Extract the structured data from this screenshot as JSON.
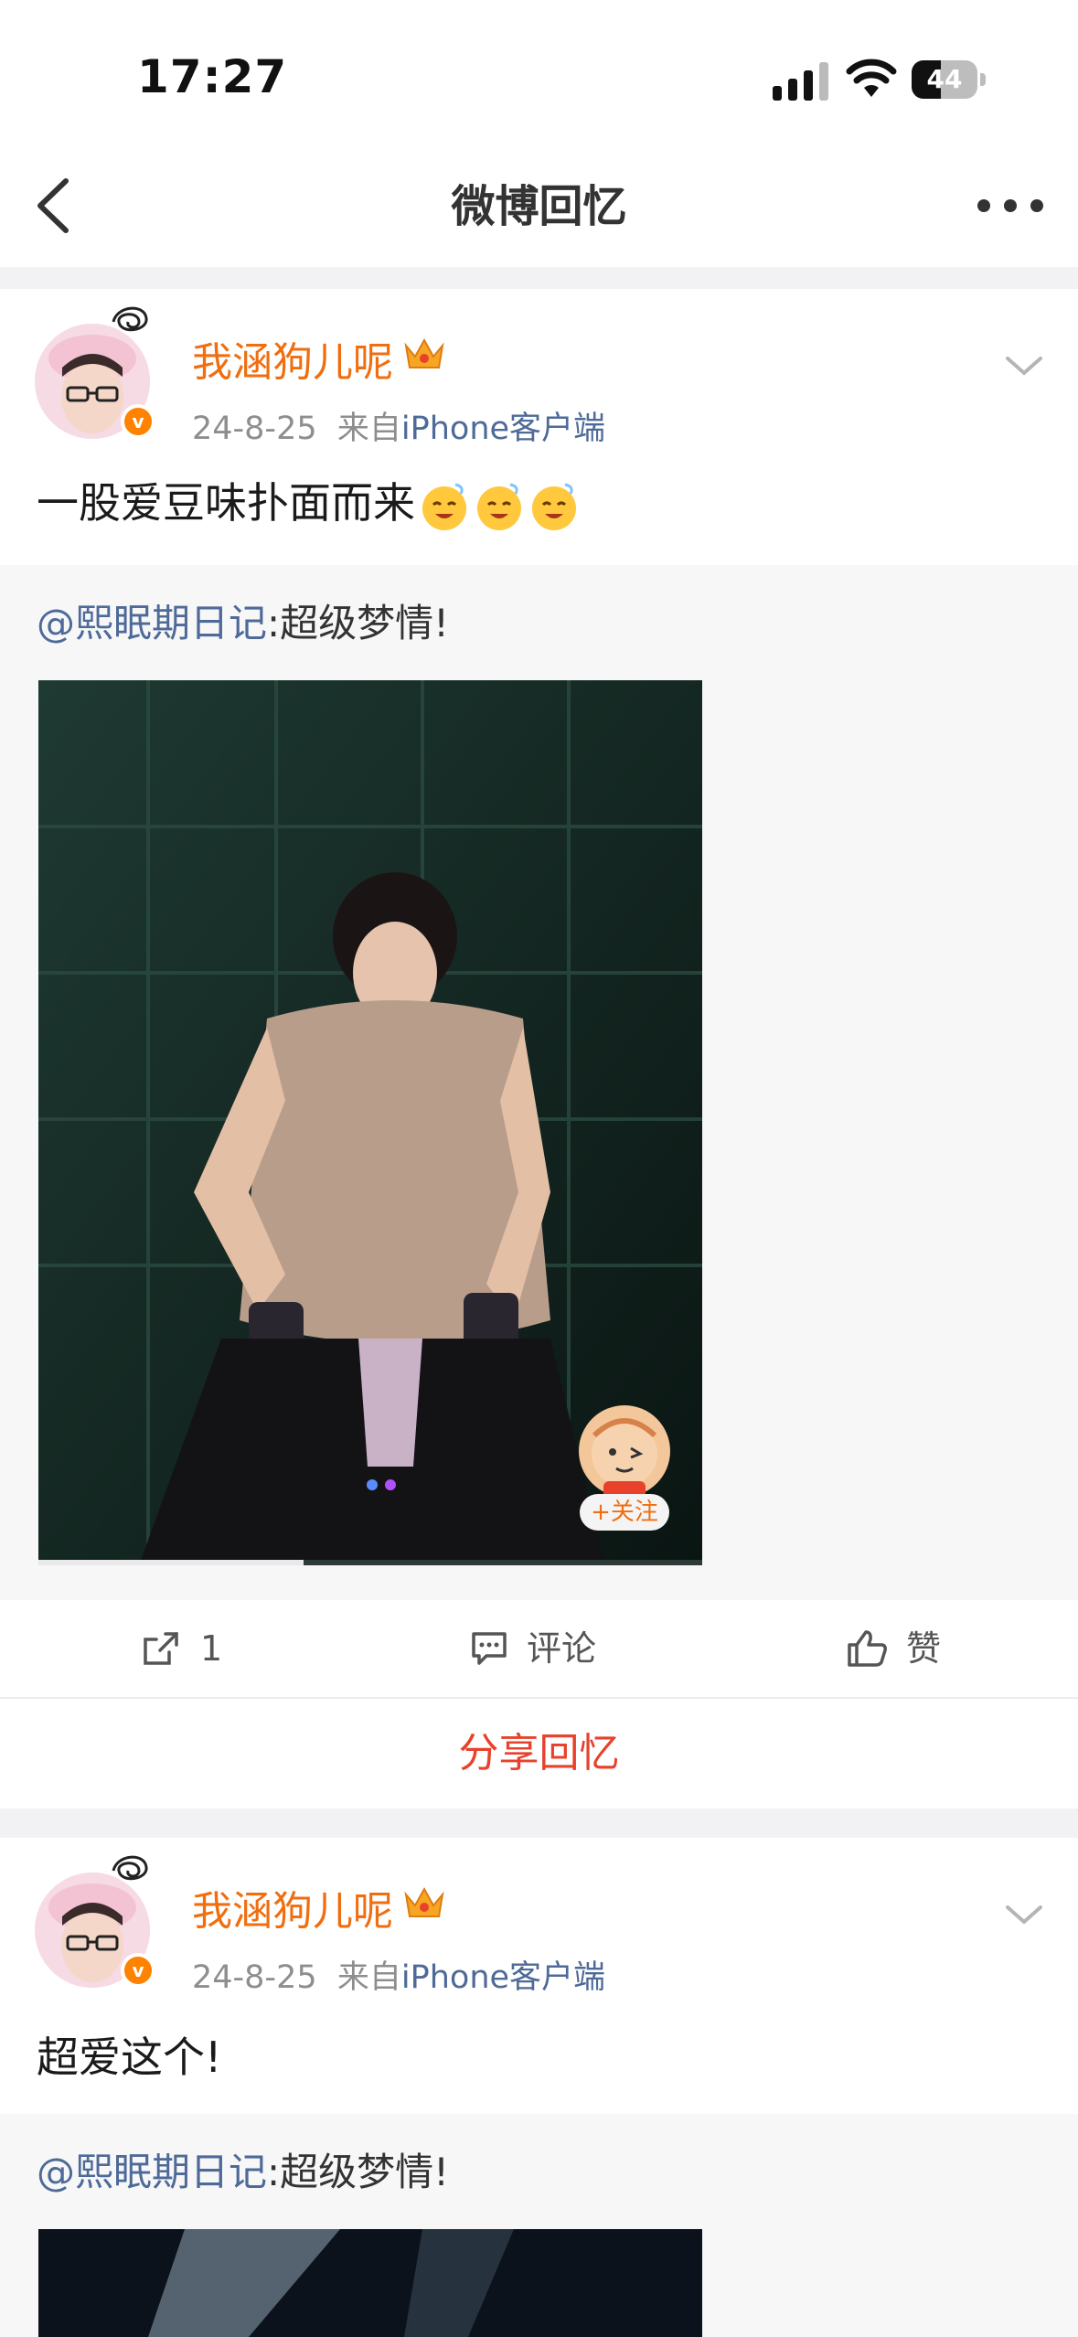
{
  "status_bar": {
    "time": "17:27",
    "battery": "44",
    "battery_level": 0.44
  },
  "nav": {
    "title": "微博回忆"
  },
  "posts": [
    {
      "username": "我涵狗儿呢",
      "date": "24-8-25",
      "source_prefix": "来自",
      "source": "iPhone客户端",
      "text": "一股爱豆味扑面而来",
      "emoji_count": 3,
      "repost": {
        "mention": "@熙眠期日记",
        "text": ":超级梦情!"
      },
      "video_progress": 0.4,
      "follow_label": "+关注",
      "actions": {
        "share_count": "1",
        "comment_label": "评论",
        "like_label": "赞"
      },
      "share_memory_label": "分享回忆"
    },
    {
      "username": "我涵狗儿呢",
      "date": "24-8-25",
      "source_prefix": "来自",
      "source": "iPhone客户端",
      "text": "超爱这个!",
      "repost": {
        "mention": "@熙眠期日记",
        "text": ":超级梦情!"
      }
    }
  ],
  "colors": {
    "accent_orange": "#f06e0f",
    "link_blue": "#4e6a98",
    "share_red": "#e8412c"
  }
}
